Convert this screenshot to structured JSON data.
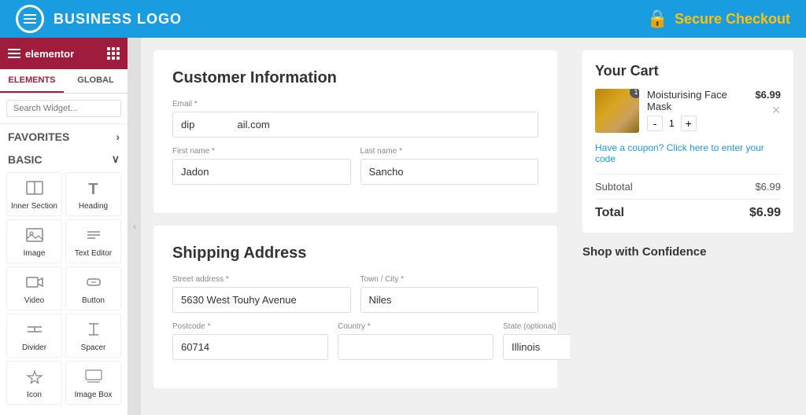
{
  "topbar": {
    "logo_text": "BUSINESS LOGO",
    "secure_checkout": "Secure Checkout"
  },
  "sidebar": {
    "brand": "elementor",
    "tabs": [
      "ELEMENTS",
      "GLOBAL"
    ],
    "active_tab": "ELEMENTS",
    "search_placeholder": "Search Widget...",
    "sections": {
      "favorites": {
        "label": "FAVORITES",
        "has_arrow": true
      },
      "basic": {
        "label": "BASIC",
        "has_toggle": true
      }
    },
    "items": [
      {
        "id": "inner-section",
        "label": "Inner Section",
        "icon": "⊞"
      },
      {
        "id": "heading",
        "label": "Heading",
        "icon": "T"
      },
      {
        "id": "image",
        "label": "Image",
        "icon": "🖼"
      },
      {
        "id": "text-editor",
        "label": "Text Editor",
        "icon": "≡"
      },
      {
        "id": "video",
        "label": "Video",
        "icon": "▶"
      },
      {
        "id": "button",
        "label": "Button",
        "icon": "⊡"
      },
      {
        "id": "divider",
        "label": "Divider",
        "icon": "÷"
      },
      {
        "id": "spacer",
        "label": "Spacer",
        "icon": "↕"
      },
      {
        "id": "icon",
        "label": "Icon",
        "icon": "☆"
      },
      {
        "id": "image-box",
        "label": "Image Box",
        "icon": "⊡"
      }
    ]
  },
  "customer_info": {
    "title": "Customer Information",
    "email_label": "Email *",
    "email_value": "dip               ail.com",
    "first_name_label": "First name *",
    "first_name_value": "Jadon",
    "last_name_label": "Last name *",
    "last_name_value": "Sancho"
  },
  "shipping": {
    "title": "Shipping Address",
    "street_label": "Street address *",
    "street_value": "5630 West Touhy Avenue",
    "city_label": "Town / City *",
    "city_value": "Niles",
    "postcode_label": "Postcode *",
    "postcode_value": "60714",
    "country_label": "Country *",
    "country_value": "",
    "state_label": "State (optional)",
    "state_value": "Illinois"
  },
  "cart": {
    "title": "Your Cart",
    "item_name": "Moisturising Face Mask",
    "item_price": "$6.99",
    "item_qty": "1",
    "coupon_text": "Have a coupon? Click here to enter your code",
    "subtotal_label": "Subtotal",
    "subtotal_value": "$6.99",
    "total_label": "Total",
    "total_value": "$6.99",
    "confidence_title": "Shop with Confidence"
  }
}
